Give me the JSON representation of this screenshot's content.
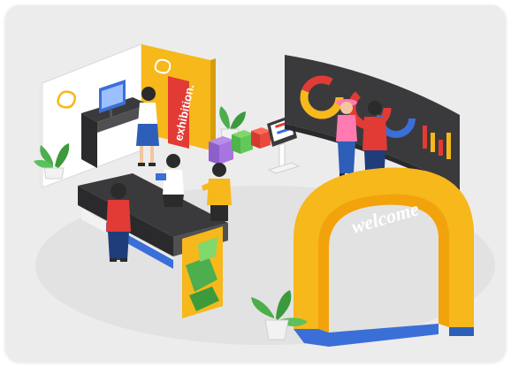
{
  "scene": {
    "banner_text": "exhibition.",
    "arch_text": "welcome"
  },
  "colors": {
    "card_background": "#ececec",
    "accent_yellow": "#f6b81a",
    "accent_red": "#e23a35",
    "accent_blue": "#3b6fd8",
    "dark_panel": "#3a3a3c",
    "plant_green": "#4cae4c"
  }
}
